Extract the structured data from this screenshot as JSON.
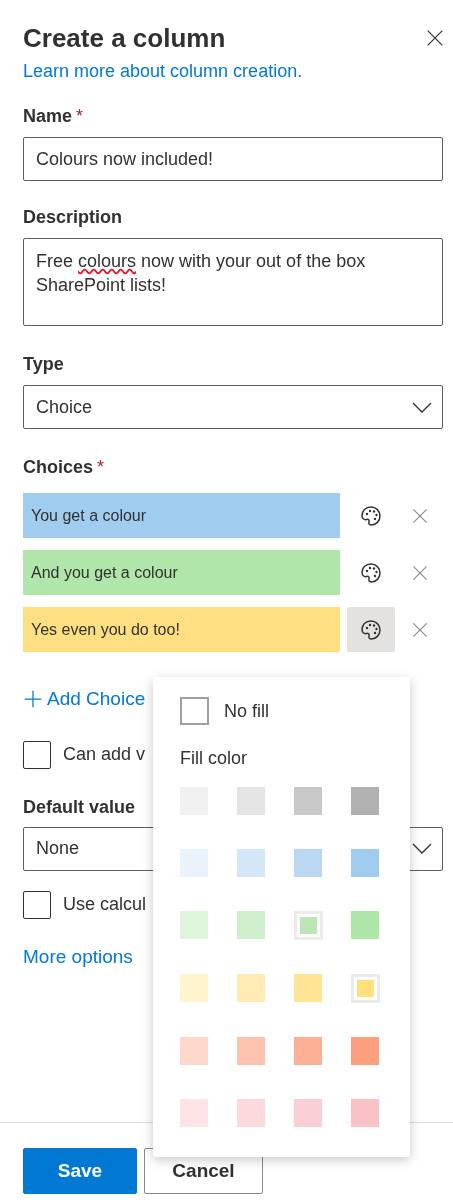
{
  "panel": {
    "title": "Create a column",
    "learn_link": "Learn more about column creation."
  },
  "name": {
    "label": "Name",
    "required_mark": "*",
    "value": "Colours now included!"
  },
  "description": {
    "label": "Description",
    "value_parts": [
      {
        "text": "Free ",
        "misspelled": false
      },
      {
        "text": "colours",
        "misspelled": true
      },
      {
        "text": " now with your out of the box SharePoint lists!",
        "misspelled": false
      }
    ]
  },
  "type": {
    "label": "Type",
    "value": "Choice"
  },
  "choices": {
    "label": "Choices",
    "required_mark": "*",
    "items": [
      {
        "text": "You get a colour",
        "color": "#a0cdef",
        "picker_open": false
      },
      {
        "text": "And you get a colour",
        "color": "#b0e6a9",
        "picker_open": false
      },
      {
        "text": "Yes even you do too!",
        "color": "#fee083",
        "picker_open": true
      }
    ],
    "add_label": "Add Choice"
  },
  "can_add_values": {
    "label": "Can add v",
    "checked": false
  },
  "default_value": {
    "label": "Default value",
    "value": "None"
  },
  "use_calculated": {
    "label": "Use calcul",
    "checked": false
  },
  "more_options": "More options",
  "buttons": [
    {
      "label": "Save",
      "kind": "primary"
    },
    {
      "label": "Cancel",
      "kind": "secondary"
    }
  ],
  "color_picker": {
    "no_fill": {
      "label": "No fill",
      "checked": false
    },
    "fill_label": "Fill color",
    "swatches": [
      {
        "color": "#f1f1f1",
        "selected": false
      },
      {
        "color": "#e5e5e5",
        "selected": false
      },
      {
        "color": "#c8c8c8",
        "selected": false
      },
      {
        "color": "#b1b1b1",
        "selected": false
      },
      {
        "color": "#eaf3fc",
        "selected": false
      },
      {
        "color": "#d4e7f8",
        "selected": false
      },
      {
        "color": "#bad8f3",
        "selected": false
      },
      {
        "color": "#a0cdef",
        "selected": false
      },
      {
        "color": "#dff6dd",
        "selected": false
      },
      {
        "color": "#cfefcc",
        "selected": false
      },
      {
        "color": "#bce6b6",
        "selected": true
      },
      {
        "color": "#aee5a9",
        "selected": false
      },
      {
        "color": "#fff4ce",
        "selected": false
      },
      {
        "color": "#ffebb3",
        "selected": false
      },
      {
        "color": "#ffe495",
        "selected": false
      },
      {
        "color": "#ffe07c",
        "selected": true
      },
      {
        "color": "#fed6ca",
        "selected": false
      },
      {
        "color": "#fdc3ae",
        "selected": false
      },
      {
        "color": "#fdb096",
        "selected": false
      },
      {
        "color": "#fd9e7c",
        "selected": false
      },
      {
        "color": "#fce4e7",
        "selected": false
      },
      {
        "color": "#fbd9dd",
        "selected": false
      },
      {
        "color": "#fbcfd6",
        "selected": false
      },
      {
        "color": "#f9c2c7",
        "selected": false
      }
    ]
  }
}
